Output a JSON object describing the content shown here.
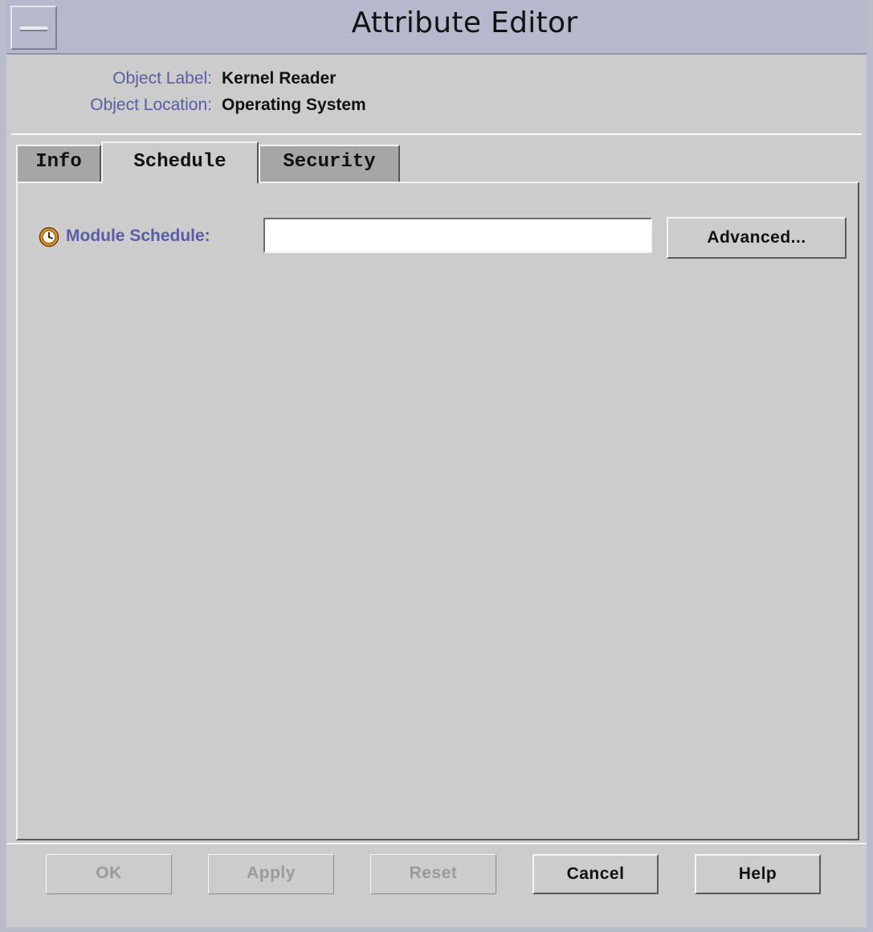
{
  "window": {
    "title": "Attribute Editor"
  },
  "object_info": {
    "label_caption": "Object Label:",
    "label_value": "Kernel Reader",
    "location_caption": "Object Location:",
    "location_value": "Operating System"
  },
  "tabs": [
    {
      "label": "Info",
      "selected": false
    },
    {
      "label": "Schedule",
      "selected": true
    },
    {
      "label": "Security",
      "selected": false
    }
  ],
  "schedule": {
    "icon": "clock-icon",
    "label": "Module Schedule:",
    "value": "",
    "advanced_label": "Advanced..."
  },
  "footer": {
    "ok_label": "OK",
    "apply_label": "Apply",
    "reset_label": "Reset",
    "cancel_label": "Cancel",
    "help_label": "Help",
    "disabled": [
      "OK",
      "Apply",
      "Reset"
    ]
  },
  "colors": {
    "title_bar": "#b6b9cc",
    "label_text": "#5a5da5",
    "background": "#cccccc",
    "clock_icon": "#e39b2a"
  }
}
